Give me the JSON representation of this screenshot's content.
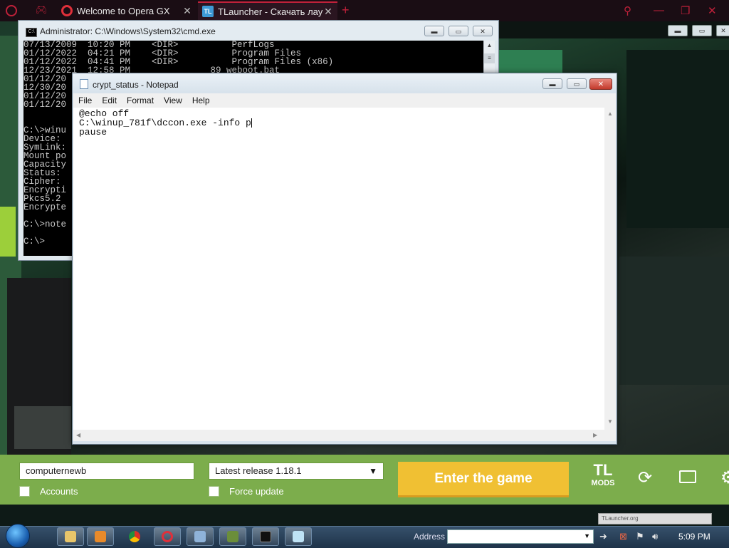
{
  "browser": {
    "tabs": [
      {
        "title": "Welcome to Opera GX"
      },
      {
        "title": "TLauncher - Скачать лаунч"
      }
    ],
    "new_tab": "+",
    "close_symbol": "✕",
    "accent_color": "#c0213a"
  },
  "cmd": {
    "title": "Administrator: C:\\Windows\\System32\\cmd.exe",
    "lines": [
      "07/13/2009  10:20 PM    <DIR>          PerfLogs",
      "01/12/2022  04:21 PM    <DIR>          Program Files",
      "01/12/2022  04:41 PM    <DIR>          Program Files (x86)",
      "12/23/2021  12:58 PM               89 weboot.bat",
      "01/12/20",
      "12/30/20",
      "01/12/20",
      "01/12/20",
      "",
      "",
      "C:\\>winu",
      "Device:",
      "SymLink:",
      "Mount po",
      "Capacity",
      "Status:",
      "Cipher:",
      "Encrypti",
      "Pkcs5.2",
      "Encrypte",
      "",
      "C:\\>note",
      "",
      "C:\\>"
    ]
  },
  "notepad": {
    "title": "crypt_status - Notepad",
    "menu": [
      "File",
      "Edit",
      "Format",
      "View",
      "Help"
    ],
    "content": [
      "@echo off",
      "C:\\winup_781f\\dccon.exe -info p",
      "pause"
    ]
  },
  "launcher": {
    "username": "computernewb",
    "version": "Latest release 1.18.1",
    "accounts_label": "Accounts",
    "force_update_label": "Force update",
    "enter_button": "Enter the game",
    "mods_logo_top": "TL",
    "mods_logo_bottom": "MODS",
    "mini_title": "TLauncher.org",
    "colors": {
      "bar": "#7cad4c",
      "enter": "#f0c033"
    }
  },
  "taskbar": {
    "address_label": "Address",
    "address_value": "",
    "clock": "5:09 PM"
  }
}
